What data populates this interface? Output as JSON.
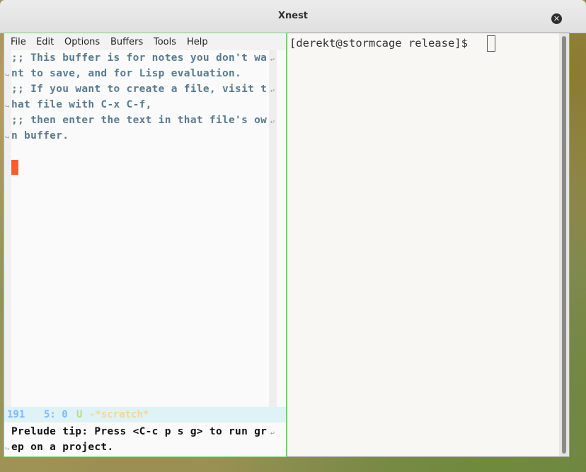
{
  "window": {
    "title": "Xnest",
    "close_glyph": "✕"
  },
  "emacs": {
    "menu": [
      "File",
      "Edit",
      "Options",
      "Buffers",
      "Tools",
      "Help"
    ],
    "lines": [
      ";; This buffer is for notes you don't wa",
      "nt to save, and for Lisp evaluation.",
      ";; If you want to create a file, visit t",
      "hat file with C-x C-f,",
      ";; then enter the text in that file's ow",
      "n buffer."
    ],
    "modeline": {
      "line": "191",
      "position": "5: 0",
      "flags": "U",
      "buffer": "-*scratch*"
    },
    "minibuffer": [
      "Prelude tip: Press <C-c p s g> to run gr",
      "ep on a project."
    ],
    "colors": {
      "comment": "#5a7a8f",
      "cursor": "#ff5a2a",
      "modeline_bg": "#dff2f6",
      "modeline_line": "#7fb8ff",
      "modeline_flag": "#b6e07a",
      "modeline_buffer": "#f2d79a",
      "frame_border": "#7ed67e"
    }
  },
  "terminal": {
    "prompt": "[derekt@stormcage release]$"
  }
}
